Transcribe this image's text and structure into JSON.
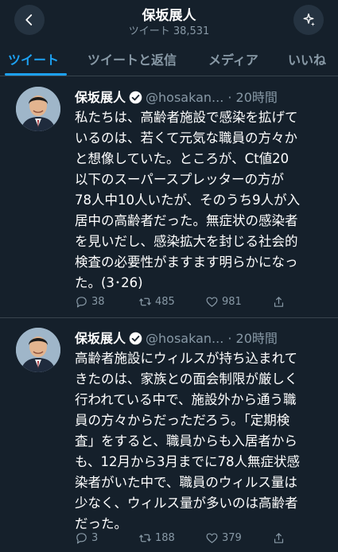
{
  "header": {
    "title": "保坂展人",
    "subtitle": "ツイート 38,531"
  },
  "tabs": [
    {
      "label": "ツイート",
      "active": true
    },
    {
      "label": "ツイートと返信",
      "active": false
    },
    {
      "label": "メディア",
      "active": false
    },
    {
      "label": "いいね",
      "active": false
    }
  ],
  "tweets": [
    {
      "name": "保坂展人",
      "handle": "@hosakan...",
      "time": "· 20時間",
      "lines": [
        "私たちは、高齢者施設で感染を拡げて",
        "いるのは、若くて元気な職員の方々か",
        "と想像していた。ところが、Ct値20",
        "以下のスーパースプレッターの方が",
        "78人中10人いたが、そのうち9人が入",
        "居中の高齢者だった。無症状の感染者",
        "を見いだし、感染拡大を封じる社会的",
        "検査の必要性がますます明らかになっ",
        "た。(3･26)"
      ],
      "replies": "38",
      "retweets": "485",
      "likes": "981"
    },
    {
      "name": "保坂展人",
      "handle": "@hosakan...",
      "time": "· 20時間",
      "lines": [
        "高齢者施設にウィルスが持ち込まれて",
        "きたのは、家族との面会制限が厳しく",
        "行われている中で、施設外から通う職",
        "員の方々からだっただろう。「定期検",
        "査」をすると、職員からも入居者から",
        "も、12月から3月までに78人無症状感",
        "染者がいた中で、職員のウィルス量は",
        "少なく、ウィルス量が多いのは高齢者",
        "だった。"
      ],
      "replies": "3",
      "retweets": "188",
      "likes": "379"
    }
  ],
  "icons": {
    "back": "arrow-left-icon",
    "top_right": "sparkle-icon",
    "verified": "verified-badge-icon",
    "reply": "reply-icon",
    "retweet": "retweet-icon",
    "like": "heart-icon",
    "share": "share-icon"
  },
  "colors": {
    "background": "#15202b",
    "accent": "#1da1f2",
    "secondary_text": "#8899a6",
    "divider": "#38444d"
  }
}
